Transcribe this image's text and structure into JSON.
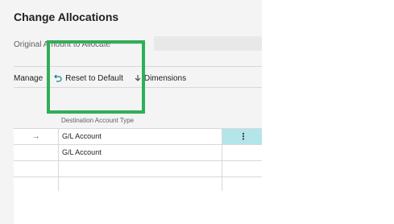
{
  "dialog": {
    "title": "Change Allocations",
    "original_account_label": "Original Amount to Allocate",
    "original_account_value": ""
  },
  "toolbar": {
    "manage_label": "Manage",
    "reset_label": "Reset to Default",
    "dimensions_label": "Dimensions"
  },
  "table": {
    "column_header": "Destination Account Type",
    "rows": [
      {
        "marker": "→",
        "type": "G/L Account",
        "menu": "⋮"
      },
      {
        "marker": "",
        "type": "G/L Account",
        "menu": ""
      },
      {
        "marker": "",
        "type": "",
        "menu": ""
      },
      {
        "marker": "",
        "type": "",
        "menu": ""
      }
    ]
  },
  "colors": {
    "highlight_box": "#2fae59",
    "active_cell": "#b3e5ea",
    "reset_icon": "#0a7f8c"
  },
  "icons": {
    "reset": "undo-icon",
    "dimensions": "arrow-down-icon",
    "row_marker": "right-arrow-icon",
    "row_menu": "more-vertical-icon"
  }
}
